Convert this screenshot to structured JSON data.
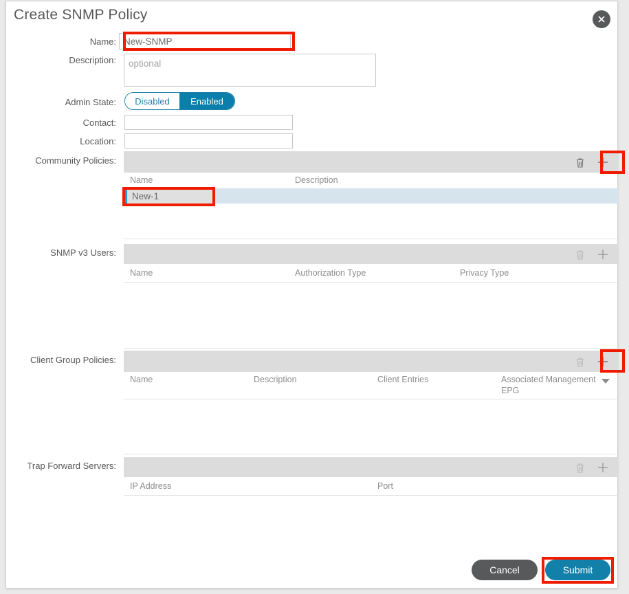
{
  "dialog": {
    "title": "Create SNMP Policy",
    "close_icon": "close-icon"
  },
  "form": {
    "name": {
      "label": "Name:",
      "value": "New-SNMP",
      "placeholder": ""
    },
    "description": {
      "label": "Description:",
      "value": "",
      "placeholder": "optional"
    },
    "admin_state": {
      "label": "Admin State:",
      "options": [
        "Disabled",
        "Enabled"
      ],
      "selected": "Enabled"
    },
    "contact": {
      "label": "Contact:",
      "value": "",
      "placeholder": ""
    },
    "location": {
      "label": "Location:",
      "value": "",
      "placeholder": ""
    }
  },
  "sections": {
    "community_policies": {
      "label": "Community Policies:",
      "delete_icon": "trash-icon",
      "add_icon": "plus-icon",
      "columns": [
        "Name",
        "Description"
      ],
      "rows": [
        {
          "name": "New-1",
          "description": ""
        }
      ]
    },
    "snmp_v3_users": {
      "label": "SNMP v3 Users:",
      "delete_icon": "trash-icon",
      "add_icon": "plus-icon",
      "columns": [
        "Name",
        "Authorization Type",
        "Privacy Type"
      ],
      "rows": []
    },
    "client_group_policies": {
      "label": "Client Group Policies:",
      "delete_icon": "trash-icon",
      "add_icon": "plus-icon",
      "columns": [
        "Name",
        "Description",
        "Client Entries",
        "Associated Management\nEPG"
      ],
      "sort_icon": "chevron-down-icon",
      "rows": []
    },
    "trap_forward_servers": {
      "label": "Trap Forward Servers:",
      "delete_icon": "trash-icon",
      "add_icon": "plus-icon",
      "columns": [
        "IP Address",
        "Port"
      ],
      "rows": []
    }
  },
  "footer": {
    "cancel_label": "Cancel",
    "submit_label": "Submit"
  },
  "colors": {
    "accent_blue": "#0b7fab",
    "submit_blue": "#1280a8",
    "cancel_gray": "#58595b",
    "highlight_red": "#f01c00",
    "toolbar_gray": "#dcdcdc",
    "selected_row": "#d6e4ee"
  }
}
